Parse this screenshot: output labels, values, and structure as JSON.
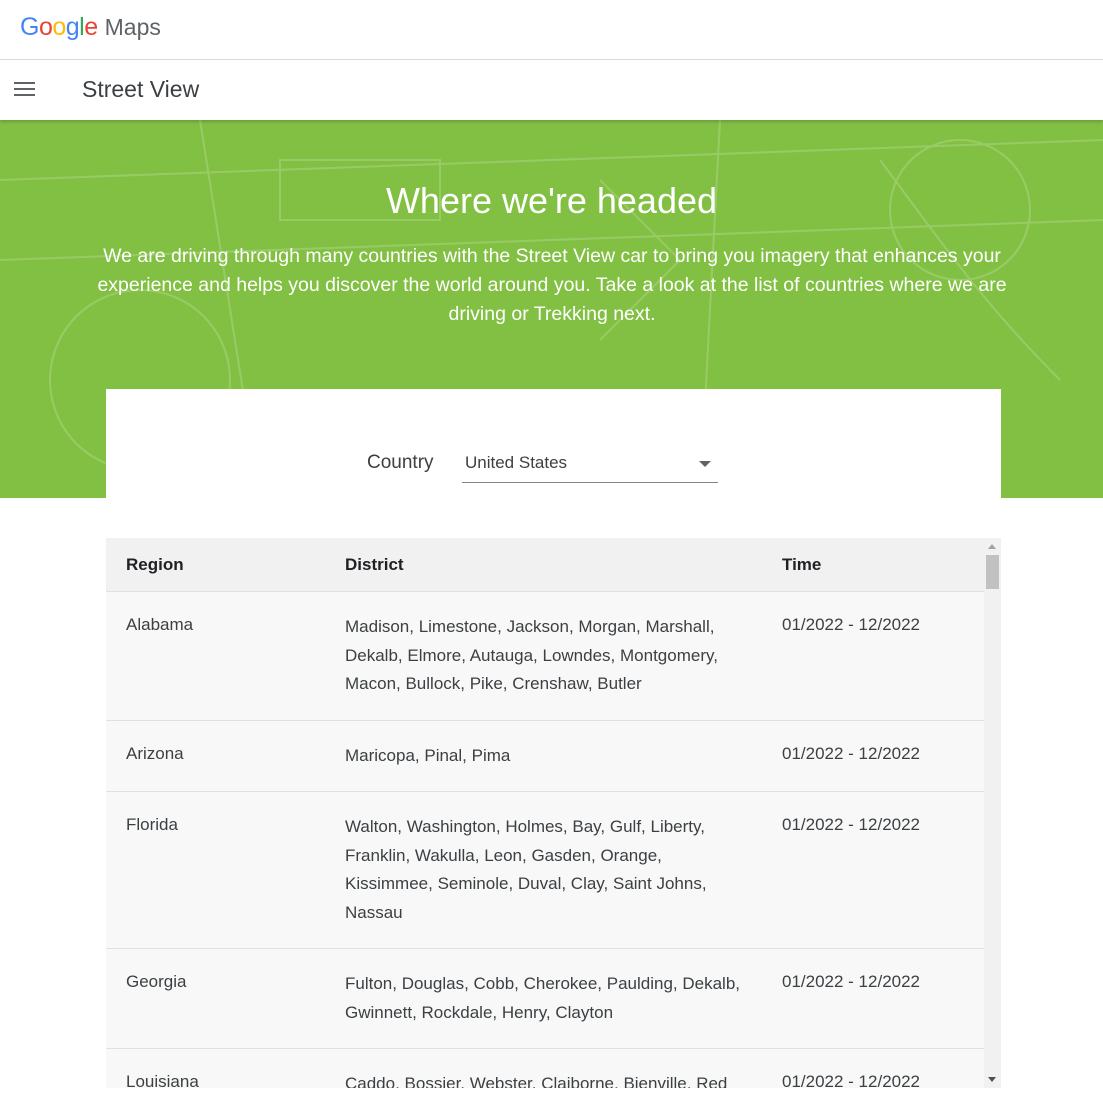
{
  "brand": {
    "logo_letters": [
      "G",
      "o",
      "o",
      "g",
      "l",
      "e"
    ],
    "product": "Maps",
    "colors": {
      "blue": "#4285f4",
      "red": "#ea4335",
      "yellow": "#fbbc05",
      "green": "#34a853"
    }
  },
  "navbar": {
    "menu_icon": "hamburger-menu-icon",
    "title": "Street View"
  },
  "hero": {
    "background_color": "#82c044",
    "title": "Where we're headed",
    "description": "We are driving through many countries with the Street View car to bring you imagery that enhances your experience and helps you discover the world around you. Take a look at the list of countries where we are driving or Trekking next."
  },
  "filter": {
    "label": "Country",
    "selected": "United States",
    "dropdown_icon": "caret-down-icon"
  },
  "table": {
    "headers": {
      "region": "Region",
      "district": "District",
      "time": "Time"
    },
    "rows": [
      {
        "region": "Alabama",
        "district": "Madison, Limestone, Jackson, Morgan, Marshall, Dekalb, Elmore, Autauga, Lowndes, Montgomery, Macon, Bullock, Pike, Crenshaw, Butler",
        "time": "01/2022 - 12/2022"
      },
      {
        "region": "Arizona",
        "district": "Maricopa, Pinal, Pima",
        "time": "01/2022 - 12/2022"
      },
      {
        "region": "Florida",
        "district": "Walton, Washington, Holmes, Bay, Gulf, Liberty, Franklin, Wakulla, Leon, Gasden, Orange, Kissimmee, Seminole, Duval, Clay, Saint Johns, Nassau",
        "time": "01/2022 - 12/2022"
      },
      {
        "region": "Georgia",
        "district": "Fulton, Douglas, Cobb, Cherokee, Paulding, Dekalb, Gwinnett, Rockdale, Henry, Clayton",
        "time": "01/2022 - 12/2022"
      },
      {
        "region": "Louisiana",
        "district": "Caddo, Bossier, Webster, Claiborne, Bienville, Red River",
        "time": "01/2022 - 12/2022"
      }
    ]
  }
}
